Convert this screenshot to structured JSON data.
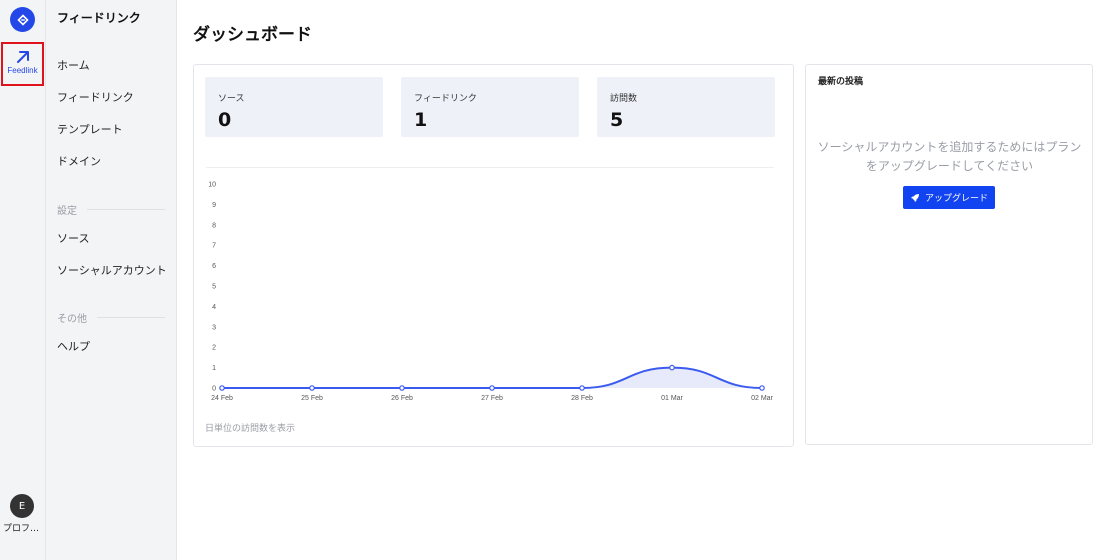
{
  "rail": {
    "active_label": "Feedlink",
    "avatar_initial": "E",
    "profile_label": "プロフ…"
  },
  "sidebar": {
    "title": "フィードリンク",
    "items": [
      {
        "label": "ホーム"
      },
      {
        "label": "フィードリンク"
      },
      {
        "label": "テンプレート"
      },
      {
        "label": "ドメイン"
      }
    ],
    "settings_section": "設定",
    "settings_items": [
      {
        "label": "ソース"
      },
      {
        "label": "ソーシャルアカウント"
      }
    ],
    "other_section": "その他",
    "other_items": [
      {
        "label": "ヘルプ"
      }
    ]
  },
  "main": {
    "title": "ダッシュボード",
    "stats": [
      {
        "label": "ソース",
        "value": "0"
      },
      {
        "label": "フィードリンク",
        "value": "1"
      },
      {
        "label": "訪問数",
        "value": "5"
      }
    ],
    "chart_note": "日単位の訪問数を表示"
  },
  "chart_data": {
    "type": "area",
    "categories": [
      "24 Feb",
      "25 Feb",
      "26 Feb",
      "27 Feb",
      "28 Feb",
      "01 Mar",
      "02 Mar"
    ],
    "values": [
      0,
      0,
      0,
      0,
      0,
      1,
      0
    ],
    "ylim": [
      0,
      10
    ],
    "yticks": [
      0,
      1,
      2,
      3,
      4,
      5,
      6,
      7,
      8,
      9,
      10
    ],
    "color": "#3b5bf0",
    "fill": "#e6eafb",
    "grid": false
  },
  "recent": {
    "title": "最新の投稿",
    "message": "ソーシャルアカウントを追加するためにはプランをアップグレードしてください",
    "button_label": "アップグレード"
  },
  "colors": {
    "accent": "#1144f0",
    "highlight_border": "#e0121b"
  }
}
